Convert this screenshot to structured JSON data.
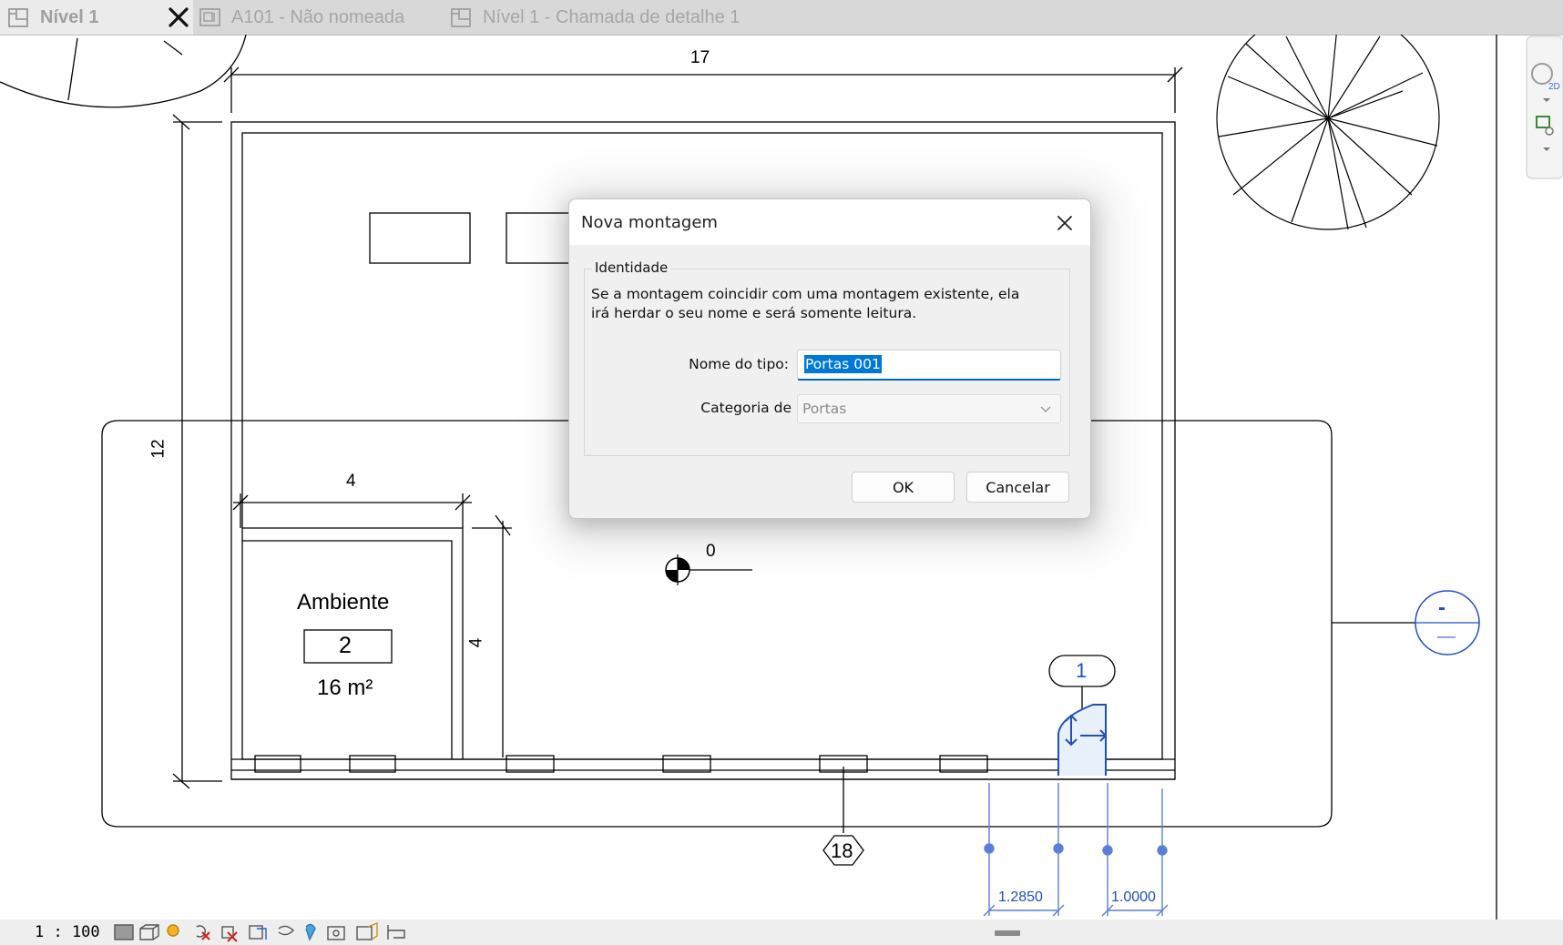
{
  "tabs": [
    {
      "label": "Nível 1",
      "active": true
    },
    {
      "label": "A101 - Não nomeada",
      "active": false
    },
    {
      "label": "Nível 1 - Chamada de detalhe 1",
      "active": false
    }
  ],
  "drawing": {
    "dim_top": "17",
    "dim_left": "12",
    "dim_room_width": "4",
    "dim_room_height": "4",
    "origin_label": "0",
    "room_name": "Ambiente",
    "room_number": "2",
    "room_area": "16 m²",
    "door_tag": "1",
    "wall_tag": "18",
    "section_tag": "-",
    "dim_door_a": "1.2850",
    "dim_door_b": "1.0000"
  },
  "dialog": {
    "title": "Nova montagem",
    "group_label": "Identidade",
    "description": "Se a montagem coincidir com uma montagem existente, ela irá herdar o seu nome e será somente leitura.",
    "name_label": "Nome do tipo:",
    "name_value": "Portas 001",
    "category_label": "Categoria de",
    "category_value": "Portas",
    "ok_label": "OK",
    "cancel_label": "Cancelar"
  },
  "status": {
    "scale": "1 : 100"
  },
  "icons": {
    "tab_view": "floor-plan-view-icon",
    "tab_sheet": "sheet-view-icon",
    "tab_close": "close-icon",
    "dialog_close": "close-icon",
    "category_dropdown": "chevron-down-icon",
    "nav_wheel": "steering-wheel-icon",
    "zoom": "zoom-region-icon",
    "origin": "project-base-point-icon"
  },
  "colors": {
    "selection": "#0078d7",
    "annotation_blue": "#1f4fbf",
    "tab_bar": "#d8d8d8"
  }
}
